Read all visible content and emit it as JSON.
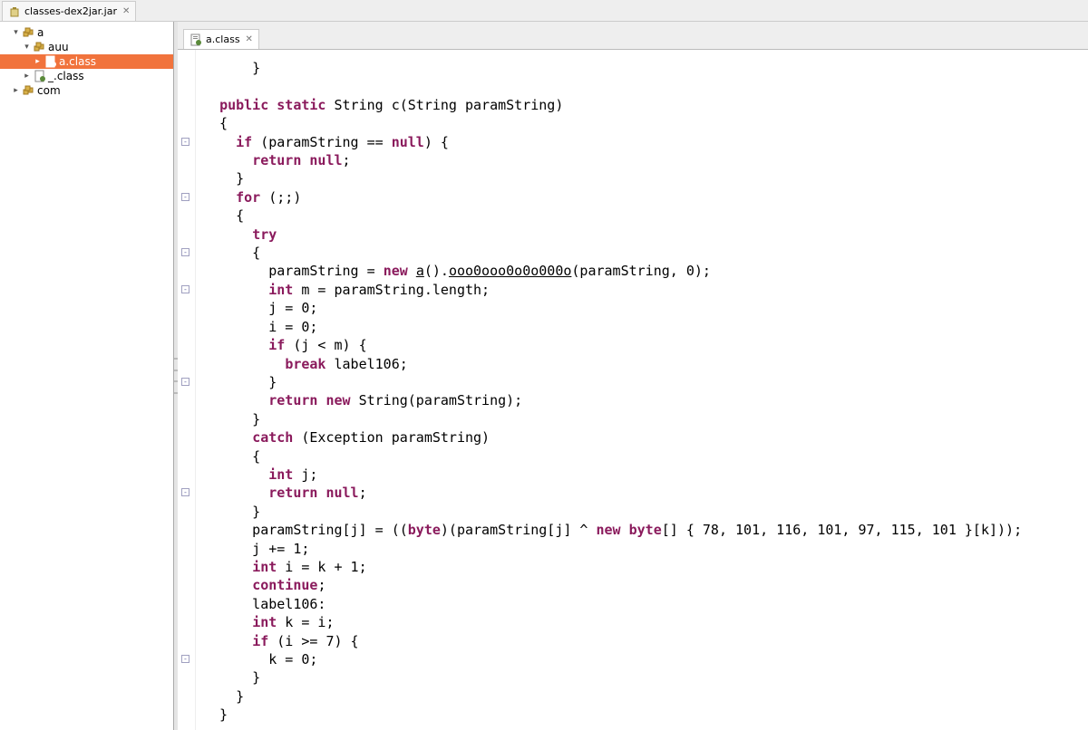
{
  "topTab": {
    "label": "classes-dex2jar.jar"
  },
  "tree": {
    "items": [
      {
        "label": "a",
        "level": 1,
        "type": "pkg",
        "tw": "▾"
      },
      {
        "label": "auu",
        "level": 2,
        "type": "pkg",
        "tw": "▾"
      },
      {
        "label": "a.class",
        "level": 3,
        "type": "file",
        "tw": "▸",
        "selected": true
      },
      {
        "label": "_.class",
        "level": 2,
        "type": "file",
        "tw": "▸"
      },
      {
        "label": "com",
        "level": 1,
        "type": "pkg",
        "tw": "▸"
      }
    ]
  },
  "editorTab": {
    "label": "a.class"
  },
  "code": {
    "tokens": [
      [
        [
          "      }"
        ]
      ],
      [
        [
          ""
        ]
      ],
      [
        [
          "  "
        ],
        [
          "public",
          "kw"
        ],
        [
          " "
        ],
        [
          "static",
          "kw"
        ],
        [
          " String c(String paramString)"
        ]
      ],
      [
        [
          "  {"
        ]
      ],
      [
        [
          "    "
        ],
        [
          "if",
          "kw"
        ],
        [
          " (paramString == "
        ],
        [
          "null",
          "kw"
        ],
        [
          ") {"
        ]
      ],
      [
        [
          "      "
        ],
        [
          "return",
          "kw"
        ],
        [
          " "
        ],
        [
          "null",
          "kw"
        ],
        [
          ";"
        ]
      ],
      [
        [
          "    }"
        ]
      ],
      [
        [
          "    "
        ],
        [
          "for",
          "kw"
        ],
        [
          " (;;)"
        ]
      ],
      [
        [
          "    {"
        ]
      ],
      [
        [
          "      "
        ],
        [
          "try",
          "kw"
        ]
      ],
      [
        [
          "      {"
        ]
      ],
      [
        [
          "        paramString = "
        ],
        [
          "new",
          "kw"
        ],
        [
          " "
        ],
        [
          "a",
          "tlink"
        ],
        [
          "()."
        ],
        [
          "ooo0ooo0o0o000o",
          "tlink"
        ],
        [
          "(paramString, 0);"
        ]
      ],
      [
        [
          "        "
        ],
        [
          "int",
          "kw"
        ],
        [
          " m = paramString.length;"
        ]
      ],
      [
        [
          "        j = 0;"
        ]
      ],
      [
        [
          "        i = 0;"
        ]
      ],
      [
        [
          "        "
        ],
        [
          "if",
          "kw"
        ],
        [
          " (j < m) {"
        ]
      ],
      [
        [
          "          "
        ],
        [
          "break",
          "kw"
        ],
        [
          " label106;"
        ]
      ],
      [
        [
          "        }"
        ]
      ],
      [
        [
          "        "
        ],
        [
          "return",
          "kw"
        ],
        [
          " "
        ],
        [
          "new",
          "kw"
        ],
        [
          " String(paramString);"
        ]
      ],
      [
        [
          "      }"
        ]
      ],
      [
        [
          "      "
        ],
        [
          "catch",
          "kw"
        ],
        [
          " (Exception paramString)"
        ]
      ],
      [
        [
          "      {"
        ]
      ],
      [
        [
          "        "
        ],
        [
          "int",
          "kw"
        ],
        [
          " j;"
        ]
      ],
      [
        [
          "        "
        ],
        [
          "return",
          "kw"
        ],
        [
          " "
        ],
        [
          "null",
          "kw"
        ],
        [
          ";"
        ]
      ],
      [
        [
          "      }"
        ]
      ],
      [
        [
          "      paramString[j] = (("
        ],
        [
          "byte",
          "kw"
        ],
        [
          ")(paramString[j] ^ "
        ],
        [
          "new",
          "kw"
        ],
        [
          " "
        ],
        [
          "byte",
          "kw"
        ],
        [
          "[] { 78, 101, 116, 101, 97, 115, 101 }[k]));"
        ]
      ],
      [
        [
          "      j += 1;"
        ]
      ],
      [
        [
          "      "
        ],
        [
          "int",
          "kw"
        ],
        [
          " i = k + 1;"
        ]
      ],
      [
        [
          "      "
        ],
        [
          "continue",
          "kw"
        ],
        [
          ";"
        ]
      ],
      [
        [
          "      label106:"
        ]
      ],
      [
        [
          "      "
        ],
        [
          "int",
          "kw"
        ],
        [
          " k = i;"
        ]
      ],
      [
        [
          "      "
        ],
        [
          "if",
          "kw"
        ],
        [
          " (i >= 7) {"
        ]
      ],
      [
        [
          "        k = 0;"
        ]
      ],
      [
        [
          "      }"
        ]
      ],
      [
        [
          "    }"
        ]
      ],
      [
        [
          "  }"
        ]
      ]
    ],
    "foldLines": [
      4,
      7,
      10,
      12,
      17,
      23,
      32
    ]
  }
}
